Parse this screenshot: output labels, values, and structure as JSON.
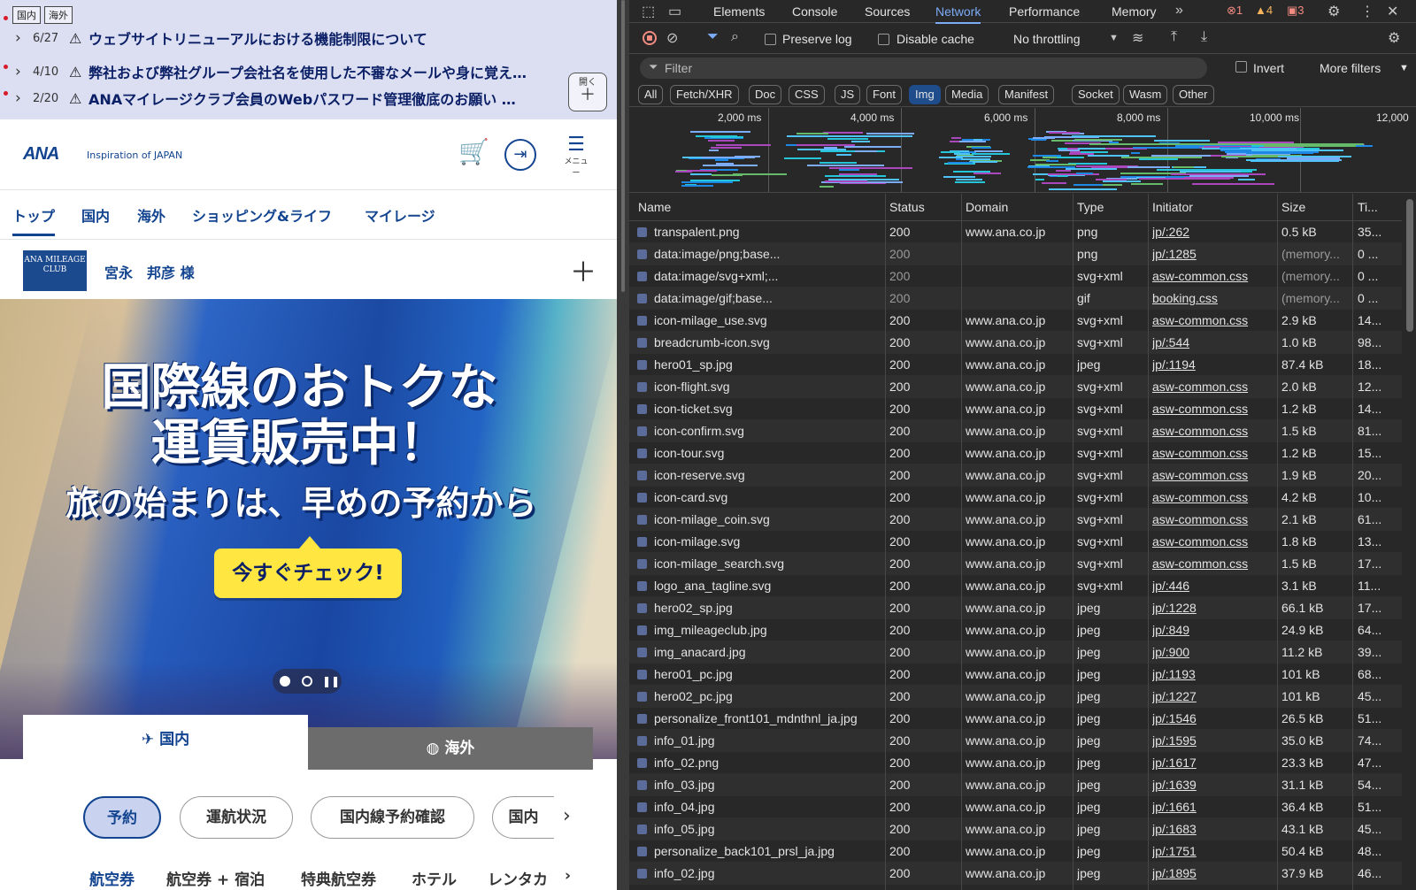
{
  "notice": {
    "tags": [
      "国内",
      "海外"
    ],
    "items": [
      {
        "date": "6/27",
        "text": "ウェブサイトリニューアルにおける機能制限について"
      },
      {
        "date": "4/10",
        "text": "弊社および弊社グループ会社名を使用した不審なメールや身に覚え…"
      },
      {
        "date": "2/20",
        "text": "ANAマイレージクラブ会員のWebパスワード管理徹底のお願い …"
      }
    ],
    "open_label": "開く"
  },
  "header": {
    "logo": "ANA",
    "tagline": "Inspiration of JAPAN",
    "menu_label": "メニュー"
  },
  "nav_tabs": [
    "トップ",
    "国内",
    "海外",
    "ショッピング&ライフ",
    "マイレージ"
  ],
  "member": {
    "card_text": "ANA MILEAGE CLUB",
    "name": "宮永　邦彦 様"
  },
  "hero": {
    "line1": "国際線のおトクな",
    "line2": "運賃販売中！",
    "line3": "旅の始まりは、早めの予約から",
    "cta": "今すぐチェック!"
  },
  "section_tabs": [
    "国内",
    "海外"
  ],
  "pills": [
    "予約",
    "運航状況",
    "国内線予約確認",
    "国内"
  ],
  "subnav": [
    "航空券",
    "航空券 + 宿泊",
    "特典航空券",
    "ホテル",
    "レンタカ"
  ],
  "devtools": {
    "tabs": [
      "Elements",
      "Console",
      "Sources",
      "Network",
      "Performance",
      "Memory"
    ],
    "active_tab": "Network",
    "errors": "1",
    "warnings": "4",
    "issues": "3",
    "preserve_log": "Preserve log",
    "disable_cache": "Disable cache",
    "throttling": "No throttling",
    "filter_placeholder": "Filter",
    "invert": "Invert",
    "more_filters": "More filters",
    "type_filters": [
      "All",
      "Fetch/XHR",
      "Doc",
      "CSS",
      "JS",
      "Font",
      "Img",
      "Media",
      "Manifest",
      "Socket",
      "Wasm",
      "Other"
    ],
    "active_type": "Img",
    "timeline_ticks": [
      "2,000 ms",
      "4,000 ms",
      "6,000 ms",
      "8,000 ms",
      "10,000 ms",
      "12,000"
    ],
    "columns": [
      "Name",
      "Status",
      "Domain",
      "Type",
      "Initiator",
      "Size",
      "Ti..."
    ],
    "rows": [
      {
        "name": "transpalent.png",
        "status": "200",
        "domain": "www.ana.co.jp",
        "type": "png",
        "initiator": "jp/:262",
        "size": "0.5 kB",
        "time": "35..."
      },
      {
        "name": "data:image/png;base...",
        "status": "200",
        "domain": "",
        "type": "png",
        "initiator": "jp/:1285",
        "size": "(memory...",
        "time": "0 ..."
      },
      {
        "name": "data:image/svg+xml;...",
        "status": "200",
        "domain": "",
        "type": "svg+xml",
        "initiator": "asw-common.css",
        "size": "(memory...",
        "time": "0 ..."
      },
      {
        "name": "data:image/gif;base...",
        "status": "200",
        "domain": "",
        "type": "gif",
        "initiator": "booking.css",
        "size": "(memory...",
        "time": "0 ..."
      },
      {
        "name": "icon-milage_use.svg",
        "status": "200",
        "domain": "www.ana.co.jp",
        "type": "svg+xml",
        "initiator": "asw-common.css",
        "size": "2.9 kB",
        "time": "14..."
      },
      {
        "name": "breadcrumb-icon.svg",
        "status": "200",
        "domain": "www.ana.co.jp",
        "type": "svg+xml",
        "initiator": "jp/:544",
        "size": "1.0 kB",
        "time": "98..."
      },
      {
        "name": "hero01_sp.jpg",
        "status": "200",
        "domain": "www.ana.co.jp",
        "type": "jpeg",
        "initiator": "jp/:1194",
        "size": "87.4 kB",
        "time": "18..."
      },
      {
        "name": "icon-flight.svg",
        "status": "200",
        "domain": "www.ana.co.jp",
        "type": "svg+xml",
        "initiator": "asw-common.css",
        "size": "2.0 kB",
        "time": "12..."
      },
      {
        "name": "icon-ticket.svg",
        "status": "200",
        "domain": "www.ana.co.jp",
        "type": "svg+xml",
        "initiator": "asw-common.css",
        "size": "1.2 kB",
        "time": "14..."
      },
      {
        "name": "icon-confirm.svg",
        "status": "200",
        "domain": "www.ana.co.jp",
        "type": "svg+xml",
        "initiator": "asw-common.css",
        "size": "1.5 kB",
        "time": "81..."
      },
      {
        "name": "icon-tour.svg",
        "status": "200",
        "domain": "www.ana.co.jp",
        "type": "svg+xml",
        "initiator": "asw-common.css",
        "size": "1.2 kB",
        "time": "15..."
      },
      {
        "name": "icon-reserve.svg",
        "status": "200",
        "domain": "www.ana.co.jp",
        "type": "svg+xml",
        "initiator": "asw-common.css",
        "size": "1.9 kB",
        "time": "20..."
      },
      {
        "name": "icon-card.svg",
        "status": "200",
        "domain": "www.ana.co.jp",
        "type": "svg+xml",
        "initiator": "asw-common.css",
        "size": "4.2 kB",
        "time": "10..."
      },
      {
        "name": "icon-milage_coin.svg",
        "status": "200",
        "domain": "www.ana.co.jp",
        "type": "svg+xml",
        "initiator": "asw-common.css",
        "size": "2.1 kB",
        "time": "61..."
      },
      {
        "name": "icon-milage.svg",
        "status": "200",
        "domain": "www.ana.co.jp",
        "type": "svg+xml",
        "initiator": "asw-common.css",
        "size": "1.8 kB",
        "time": "13..."
      },
      {
        "name": "icon-milage_search.svg",
        "status": "200",
        "domain": "www.ana.co.jp",
        "type": "svg+xml",
        "initiator": "asw-common.css",
        "size": "1.5 kB",
        "time": "17..."
      },
      {
        "name": "logo_ana_tagline.svg",
        "status": "200",
        "domain": "www.ana.co.jp",
        "type": "svg+xml",
        "initiator": "jp/:446",
        "size": "3.1 kB",
        "time": "11..."
      },
      {
        "name": "hero02_sp.jpg",
        "status": "200",
        "domain": "www.ana.co.jp",
        "type": "jpeg",
        "initiator": "jp/:1228",
        "size": "66.1 kB",
        "time": "17..."
      },
      {
        "name": "img_mileageclub.jpg",
        "status": "200",
        "domain": "www.ana.co.jp",
        "type": "jpeg",
        "initiator": "jp/:849",
        "size": "24.9 kB",
        "time": "64..."
      },
      {
        "name": "img_anacard.jpg",
        "status": "200",
        "domain": "www.ana.co.jp",
        "type": "jpeg",
        "initiator": "jp/:900",
        "size": "11.2 kB",
        "time": "39..."
      },
      {
        "name": "hero01_pc.jpg",
        "status": "200",
        "domain": "www.ana.co.jp",
        "type": "jpeg",
        "initiator": "jp/:1193",
        "size": "101 kB",
        "time": "68..."
      },
      {
        "name": "hero02_pc.jpg",
        "status": "200",
        "domain": "www.ana.co.jp",
        "type": "jpeg",
        "initiator": "jp/:1227",
        "size": "101 kB",
        "time": "45..."
      },
      {
        "name": "personalize_front101_mdnthnl_ja.jpg",
        "status": "200",
        "domain": "www.ana.co.jp",
        "type": "jpeg",
        "initiator": "jp/:1546",
        "size": "26.5 kB",
        "time": "51..."
      },
      {
        "name": "info_01.jpg",
        "status": "200",
        "domain": "www.ana.co.jp",
        "type": "jpeg",
        "initiator": "jp/:1595",
        "size": "35.0 kB",
        "time": "74..."
      },
      {
        "name": "info_02.png",
        "status": "200",
        "domain": "www.ana.co.jp",
        "type": "jpeg",
        "initiator": "jp/:1617",
        "size": "23.3 kB",
        "time": "47..."
      },
      {
        "name": "info_03.jpg",
        "status": "200",
        "domain": "www.ana.co.jp",
        "type": "jpeg",
        "initiator": "jp/:1639",
        "size": "31.1 kB",
        "time": "54..."
      },
      {
        "name": "info_04.jpg",
        "status": "200",
        "domain": "www.ana.co.jp",
        "type": "jpeg",
        "initiator": "jp/:1661",
        "size": "36.4 kB",
        "time": "51..."
      },
      {
        "name": "info_05.jpg",
        "status": "200",
        "domain": "www.ana.co.jp",
        "type": "jpeg",
        "initiator": "jp/:1683",
        "size": "43.1 kB",
        "time": "45..."
      },
      {
        "name": "personalize_back101_prsl_ja.jpg",
        "status": "200",
        "domain": "www.ana.co.jp",
        "type": "jpeg",
        "initiator": "jp/:1751",
        "size": "50.4 kB",
        "time": "48..."
      },
      {
        "name": "info_02.jpg",
        "status": "200",
        "domain": "www.ana.co.jp",
        "type": "jpeg",
        "initiator": "jp/:1895",
        "size": "37.9 kB",
        "time": "46..."
      }
    ]
  },
  "colors": {
    "ana_blue": "#13448f",
    "notice_bg": "#dcdff2",
    "devtools_bg": "#282828",
    "devtools_accent": "#7cacf8",
    "cta_yellow": "#ffe640"
  }
}
